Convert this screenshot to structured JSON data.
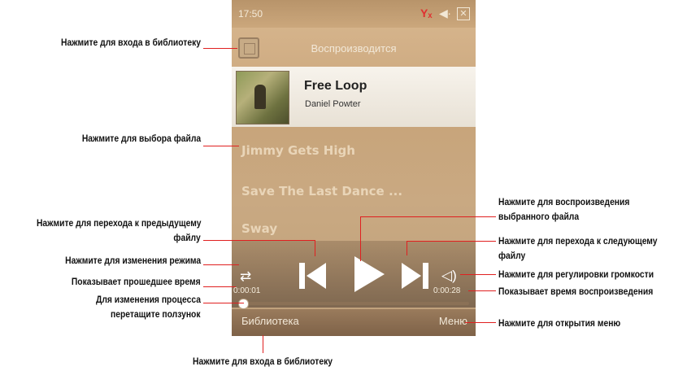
{
  "status": {
    "time": "17:50",
    "signal_glyph": "Yₓ",
    "volume_glyph": "◀∙",
    "close_glyph": "✕"
  },
  "title": "Воспроизводится",
  "now_playing": {
    "song": "Free Loop",
    "artist": "Daniel Powter"
  },
  "tracks": [
    "Jimmy Gets High",
    "Save The Last Dance ...",
    "Sway"
  ],
  "time": {
    "elapsed": "0:00:01",
    "total": "0:00:28"
  },
  "progress": 0.01,
  "softkeys": {
    "left": "Библиотека",
    "right": "Меню"
  },
  "annotations": {
    "library_top": "Нажмите для входа в библиотеку",
    "select_file": "Нажмите для выбора файла",
    "play_selected_1": "Нажмите для воспроизведения",
    "play_selected_2": "выбранного файла",
    "prev_1": "Нажмите для перехода к предыдущему",
    "prev_2": "файлу",
    "next_1": "Нажмите для перехода к следующему",
    "next_2": "файлу",
    "mode": "Нажмите для изменения режима",
    "volume": "Нажмите для регулировки громкости",
    "elapsed": "Показывает прошедшее время",
    "playback_time": "Показывает время воспроизведения",
    "drag_1": "Для изменения процесса",
    "drag_2": "перетащите ползунок",
    "menu": "Нажмите для открытия меню",
    "library_bottom": "Нажмите для входа в библиотеку"
  },
  "colors": {
    "annotation_line": "#e02020",
    "accent_signal": "#e03030"
  }
}
